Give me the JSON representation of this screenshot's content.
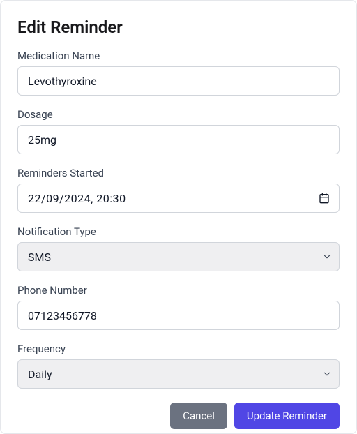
{
  "title": "Edit Reminder",
  "fields": {
    "medicationName": {
      "label": "Medication Name",
      "value": "Levothyroxine"
    },
    "dosage": {
      "label": "Dosage",
      "value": "25mg"
    },
    "remindersStarted": {
      "label": "Reminders Started",
      "value": "22/09/2024, 20:30"
    },
    "notificationType": {
      "label": "Notification Type",
      "selected": "SMS"
    },
    "phoneNumber": {
      "label": "Phone Number",
      "value": "07123456778"
    },
    "frequency": {
      "label": "Frequency",
      "selected": "Daily"
    }
  },
  "buttons": {
    "cancel": "Cancel",
    "update": "Update Reminder"
  }
}
